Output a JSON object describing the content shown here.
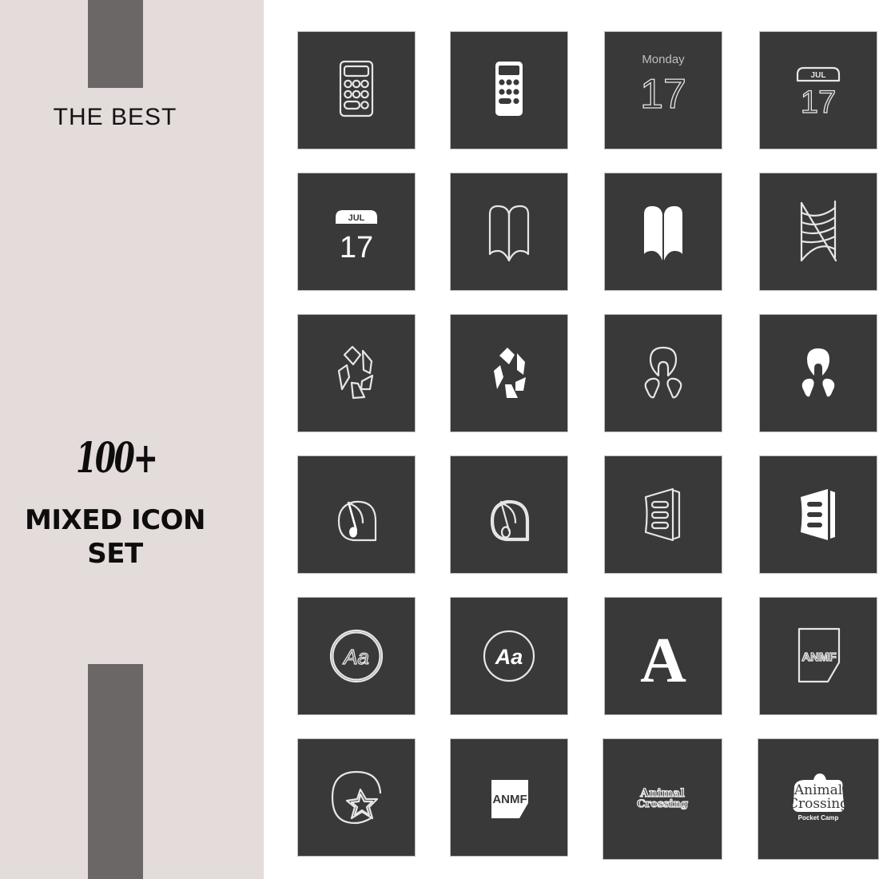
{
  "promo": {
    "tagline": "THE BEST",
    "count": "100+",
    "headline_line1": "MIXED ICON",
    "headline_line2": "SET"
  },
  "colors": {
    "panel_background": "#e3dcdb",
    "accent_bar": "#6b6766",
    "tile_background": "#393939",
    "icon_color": "#ffffff",
    "text_color": "#0e0c0c"
  },
  "icons": [
    {
      "name": "calculator-outline",
      "label": ""
    },
    {
      "name": "calculator-filled",
      "label": ""
    },
    {
      "name": "calendar-day-outline",
      "weekday": "Monday",
      "day": "17"
    },
    {
      "name": "calendar-month-outline",
      "month": "JUL",
      "day": "17"
    },
    {
      "name": "calendar-month-filled",
      "month": "JUL",
      "day": "17"
    },
    {
      "name": "book-outline",
      "label": ""
    },
    {
      "name": "book-filled",
      "label": ""
    },
    {
      "name": "abstract-wave-outline",
      "label": ""
    },
    {
      "name": "pentagon-shards-outline",
      "label": ""
    },
    {
      "name": "pentagon-shards-filled",
      "label": ""
    },
    {
      "name": "figure-logo-outline",
      "label": ""
    },
    {
      "name": "figure-logo-filled",
      "label": ""
    },
    {
      "name": "music-note-drop-outline",
      "label": ""
    },
    {
      "name": "music-note-drop-double-outline",
      "label": ""
    },
    {
      "name": "menu-card-outline",
      "label": ""
    },
    {
      "name": "menu-card-filled",
      "label": ""
    },
    {
      "name": "font-aa-double-outline",
      "text": "Aa"
    },
    {
      "name": "font-aa-outline",
      "text": "Aa"
    },
    {
      "name": "font-serif-a",
      "text": "A"
    },
    {
      "name": "anmf-outline",
      "text": "ANMF"
    },
    {
      "name": "star-circle-outline",
      "label": ""
    },
    {
      "name": "anmf-filled",
      "text": "ANMF"
    },
    {
      "name": "animal-crossing-outline",
      "line1": "Animal",
      "line2": "Crossing"
    },
    {
      "name": "animal-crossing-pocket-camp",
      "line1": "Animal",
      "line2": "Crossing",
      "line3": "Pocket   Camp"
    }
  ]
}
